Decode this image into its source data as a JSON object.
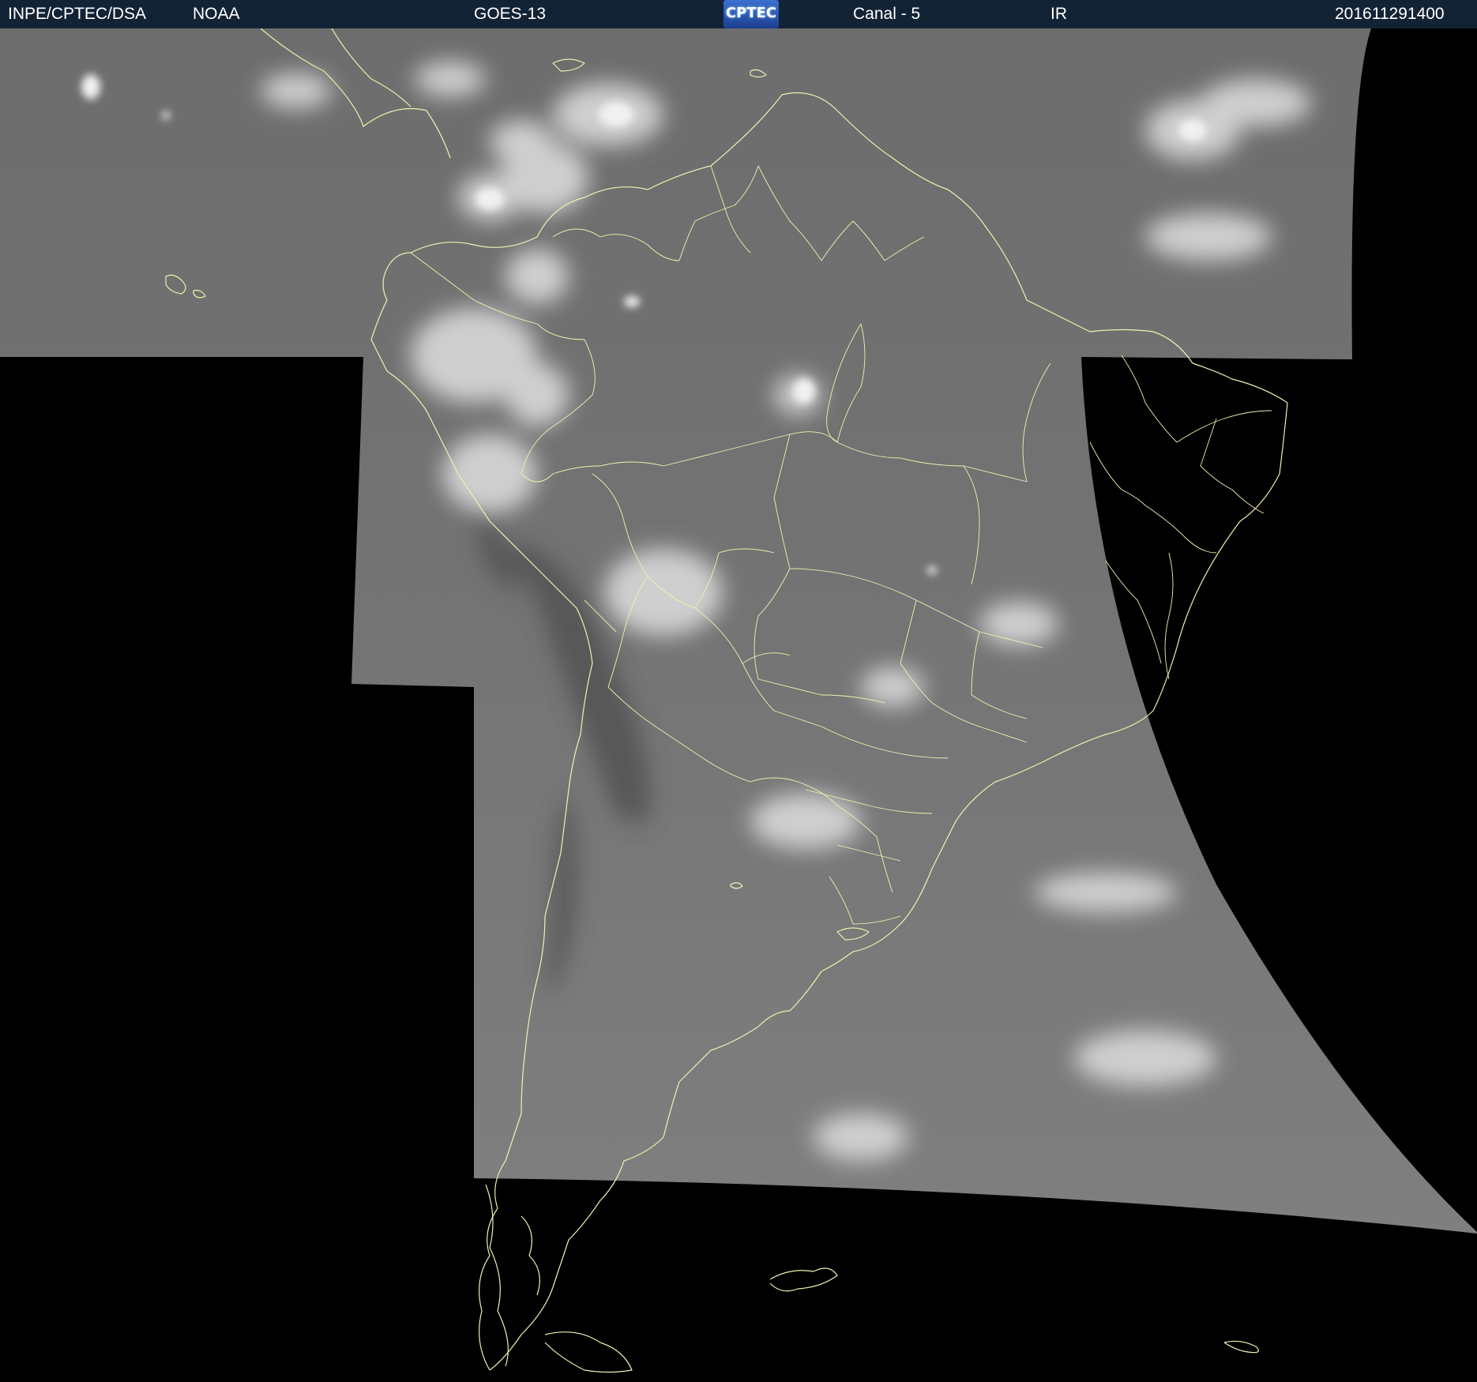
{
  "header": {
    "org": "INPE/CPTEC/DSA",
    "agency": "NOAA",
    "satellite": "GOES-13",
    "logo_text": "CPTEC",
    "channel": "Canal - 5",
    "band": "IR",
    "timestamp": "201611291400"
  },
  "map": {
    "coast_color": "#f2f0b0",
    "no_data_color": "#000000"
  }
}
